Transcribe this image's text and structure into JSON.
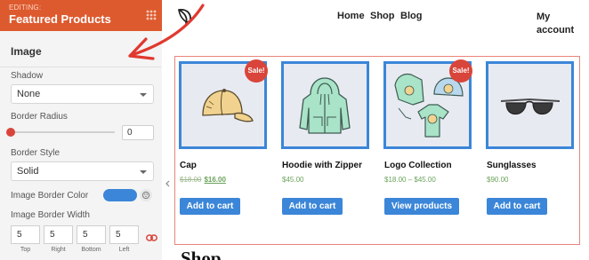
{
  "editor": {
    "editing_label": "EDITING:",
    "title": "Featured Products",
    "section_title": "Image",
    "shadow": {
      "label": "Shadow",
      "value": "None"
    },
    "border_radius": {
      "label": "Border Radius",
      "value": "0"
    },
    "border_style": {
      "label": "Border Style",
      "value": "Solid"
    },
    "image_border_color": {
      "label": "Image Border Color",
      "color": "#3b86d8"
    },
    "image_border_width": {
      "label": "Image Border Width",
      "fields": [
        {
          "side": "Top",
          "value": "5"
        },
        {
          "side": "Right",
          "value": "5"
        },
        {
          "side": "Bottom",
          "value": "5"
        },
        {
          "side": "Left",
          "value": "5"
        }
      ]
    }
  },
  "store": {
    "nav": [
      "Home",
      "Shop",
      "Blog",
      "My account"
    ],
    "products": [
      {
        "name": "Cap",
        "old_price": "$18.00",
        "price": "$16.00",
        "sale": true,
        "sale_label": "Sale!",
        "button": "Add to cart",
        "image": "cap"
      },
      {
        "name": "Hoodie with Zipper",
        "price": "$45.00",
        "sale": false,
        "button": "Add to cart",
        "image": "hoodie"
      },
      {
        "name": "Logo Collection",
        "price": "$18.00 – $45.00",
        "sale": true,
        "sale_label": "Sale!",
        "button": "View products",
        "image": "logo-collection"
      },
      {
        "name": "Sunglasses",
        "price": "$90.00",
        "sale": false,
        "button": "Add to cart",
        "image": "sunglasses"
      }
    ],
    "section_heading": "Shop"
  },
  "colors": {
    "header_orange": "#dd5a2f",
    "accent_blue": "#3b86d8",
    "sale_red": "#d9453a",
    "price_green": "#6aa35b"
  }
}
